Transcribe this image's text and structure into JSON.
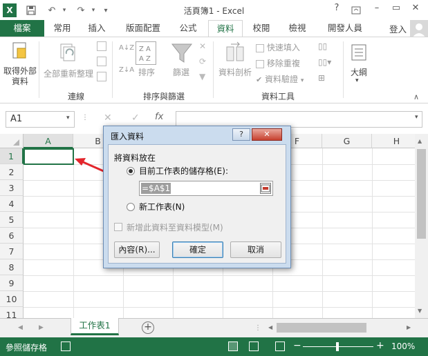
{
  "window": {
    "title": "活頁簿1 - Excel",
    "help": "?",
    "minimize": "–",
    "restore": "▭",
    "close": "✕"
  },
  "quick_access": {
    "logo": "X",
    "undo": "↶",
    "redo": "↷",
    "customize": "▾"
  },
  "tabs": [
    "檔案",
    "常用",
    "插入",
    "版面配置",
    "公式",
    "資料",
    "校閱",
    "檢視",
    "開發人員"
  ],
  "active_tab": "資料",
  "signin": "登入",
  "ribbon": {
    "get_external": "取得外部",
    "get_external2": "資料",
    "refresh_all": "全部重新整理",
    "group_connections": "連線",
    "sort_az": "A↓Z",
    "sort": "排序",
    "filter": "篩選",
    "group_sort_filter": "排序與篩選",
    "text_to_columns": "資料剖析",
    "flash_fill": "快速填入",
    "remove_duplicates": "移除重複",
    "data_validation": "資料驗證",
    "group_data_tools": "資料工具",
    "outline": "大綱"
  },
  "formula_bar": {
    "name_box": "A1",
    "cancel": "✕",
    "enter": "✓",
    "fx": "fx"
  },
  "grid": {
    "columns": [
      "A",
      "B",
      "C",
      "D",
      "E",
      "F",
      "G",
      "H"
    ],
    "rows": [
      "1",
      "2",
      "3",
      "4",
      "5",
      "6",
      "7",
      "8",
      "9",
      "10",
      "11"
    ]
  },
  "dialog": {
    "title": "匯入資料",
    "help": "?",
    "close": "✕",
    "section_label": "將資料放在",
    "option_existing": "目前工作表的儲存格(E):",
    "range_value": "=$A$1",
    "option_new": "新工作表(N)",
    "add_model": "新增此資料至資料模型(M)",
    "properties_button": "內容(R)...",
    "ok_button": "確定",
    "cancel_button": "取消"
  },
  "sheets": {
    "active": "工作表1",
    "add": "+",
    "nav_prev": "◀",
    "nav_next": "▶"
  },
  "status": {
    "mode": "參照儲存格",
    "zoom": "100%",
    "zoom_minus": "−",
    "zoom_plus": "+"
  },
  "colors": {
    "excel_green": "#217346",
    "arrow_red": "#e3262c",
    "dialog_frame": "#cbdcee"
  }
}
